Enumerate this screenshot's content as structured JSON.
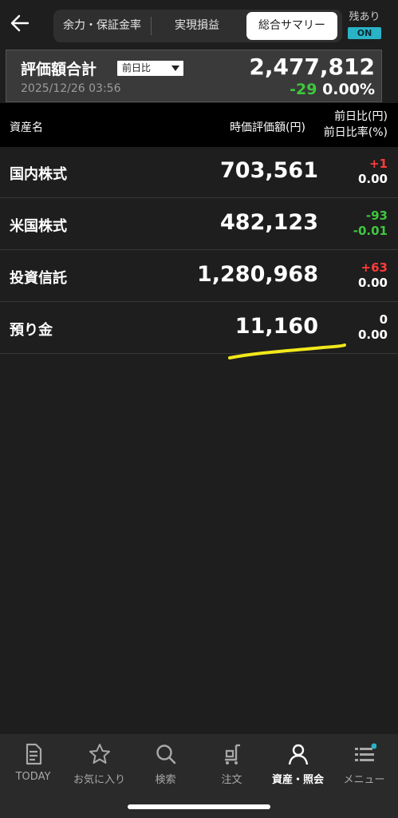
{
  "header": {
    "tabs": [
      {
        "label": "余力・保証金率"
      },
      {
        "label": "実現損益"
      },
      {
        "label": "総合サマリー"
      }
    ],
    "toggle": {
      "label": "残あり",
      "state": "ON"
    }
  },
  "summary": {
    "title": "評価額合計",
    "compare_option": "前日比",
    "datetime": "2025/12/26 03:56",
    "total": "2,477,812",
    "change": "-29",
    "change_rate": "0.00%"
  },
  "table": {
    "col_name": "資産名",
    "col_value": "時価評価額(円)",
    "col_diff": "前日比(円)",
    "col_diff_rate": "前日比率(%)",
    "rows": [
      {
        "name": "国内株式",
        "value": "703,561",
        "diff": "+1",
        "rate": "0.00"
      },
      {
        "name": "米国株式",
        "value": "482,123",
        "diff": "-93",
        "rate": "-0.01"
      },
      {
        "name": "投資信託",
        "value": "1,280,968",
        "diff": "+63",
        "rate": "0.00"
      },
      {
        "name": "預り金",
        "value": "11,160",
        "diff": "0",
        "rate": "0.00"
      }
    ]
  },
  "nav": [
    {
      "label": "TODAY"
    },
    {
      "label": "お気に入り"
    },
    {
      "label": "検索"
    },
    {
      "label": "注文"
    },
    {
      "label": "資産・照会"
    },
    {
      "label": "メニュー"
    }
  ],
  "colors": {
    "positive": "#ff3b3b",
    "negative": "#3ec73e",
    "accent": "#2ab3c7",
    "highlight_mark": "#f2e81a"
  }
}
